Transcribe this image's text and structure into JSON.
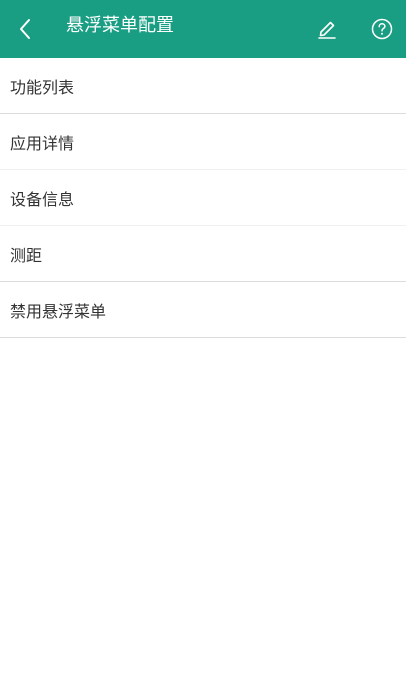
{
  "header": {
    "title": "悬浮菜单配置",
    "back_icon": "chevron-left-icon",
    "edit_icon": "pencil-icon",
    "help_icon": "question-circle-icon"
  },
  "menu": {
    "items": [
      {
        "label": "功能列表"
      },
      {
        "label": "应用详情"
      },
      {
        "label": "设备信息"
      },
      {
        "label": "测距"
      },
      {
        "label": "禁用悬浮菜单"
      }
    ]
  },
  "colors": {
    "header_bg": "#1a9e83",
    "header_fg": "#ffffff",
    "item_text": "#333333",
    "divider": "#dcdcdc"
  }
}
